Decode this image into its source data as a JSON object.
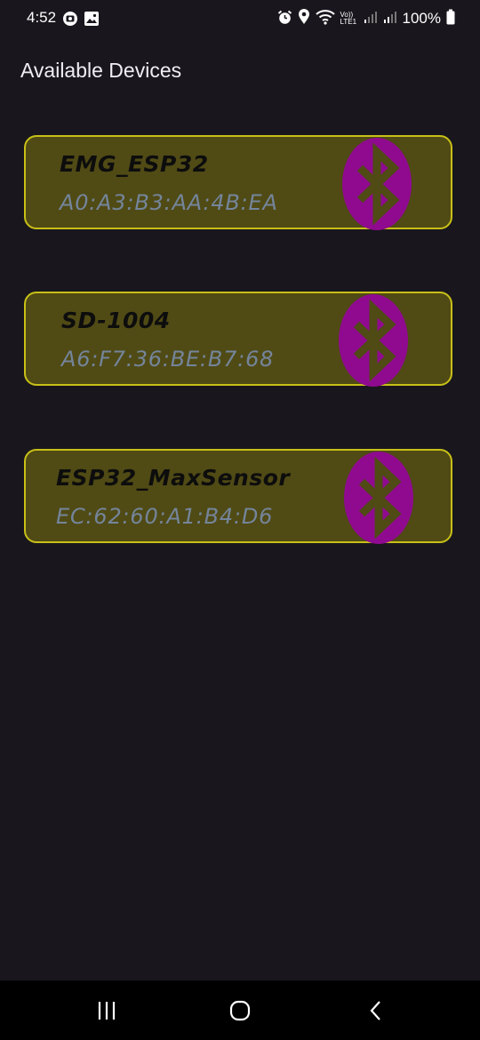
{
  "status_bar": {
    "time": "4:52",
    "battery": "100%",
    "icons": [
      "screen-record-icon",
      "gallery-icon",
      "alarm-icon",
      "location-icon",
      "wifi-icon",
      "volte-icon",
      "signal-icon",
      "signal-icon",
      "battery-icon"
    ],
    "volte_label": "Vo)) LTE1"
  },
  "page": {
    "title": "Available Devices"
  },
  "devices": [
    {
      "name": "EMG_ESP32",
      "address": "A0:A3:B3:AA:4B:EA",
      "icon": "bluetooth-icon"
    },
    {
      "name": "SD-1004",
      "address": "A6:F7:36:BE:B7:68",
      "icon": "bluetooth-icon"
    },
    {
      "name": "ESP32_MaxSensor",
      "address": "EC:62:60:A1:B4:D6",
      "icon": "bluetooth-icon"
    }
  ],
  "nav_bar": {
    "buttons": [
      "recents-icon",
      "home-icon",
      "back-icon"
    ]
  },
  "colors": {
    "background": "#19171d",
    "card_fill": "#504a15",
    "card_border": "#c8c017",
    "bluetooth_badge": "#8f0a8f",
    "address_text": "#74859a"
  }
}
